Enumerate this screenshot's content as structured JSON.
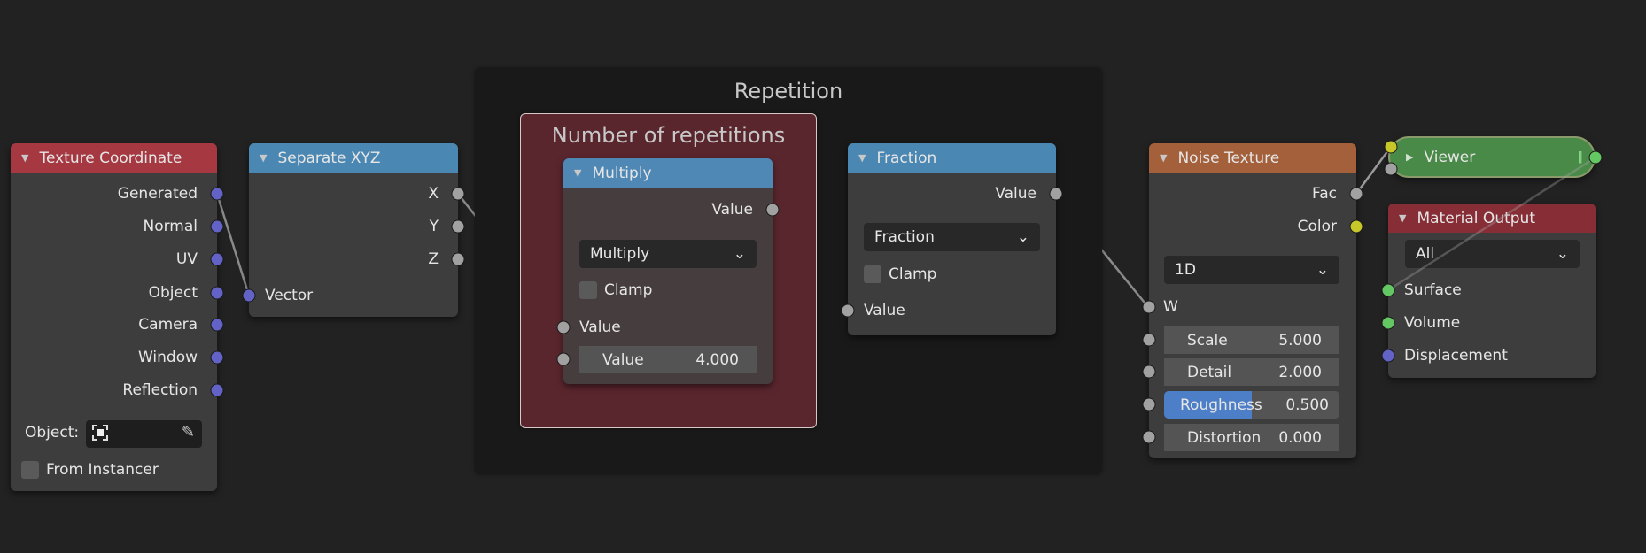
{
  "colors": {
    "background": "#222222",
    "frame": "#191919",
    "frame_inner": "#5a262e",
    "header_input": "#a53841",
    "header_converter": "#4a88b3",
    "header_texture": "#a3603a",
    "header_output": "#862d35",
    "viewer": "#4a8a48",
    "socket_vector": "#6363c7",
    "socket_float": "#a1a1a1",
    "socket_color": "#c7c729",
    "socket_shader": "#63c763",
    "slider_fill": "#4d7fc8"
  },
  "frames": {
    "outer": "Repetition",
    "inner": "Number of repetitions"
  },
  "texture_coordinate": {
    "title": "Texture Coordinate",
    "outputs": [
      "Generated",
      "Normal",
      "UV",
      "Object",
      "Camera",
      "Window",
      "Reflection"
    ],
    "object_label": "Object:",
    "object_icon": "object-icon",
    "eyedropper_icon": "eyedropper-icon",
    "from_instancer": "From Instancer",
    "from_instancer_checked": false
  },
  "separate_xyz": {
    "title": "Separate XYZ",
    "outputs": [
      "X",
      "Y",
      "Z"
    ],
    "input": "Vector"
  },
  "multiply": {
    "title": "Multiply",
    "output": "Value",
    "operation": "Multiply",
    "clamp": "Clamp",
    "clamp_checked": false,
    "input1": "Value",
    "input2_label": "Value",
    "input2_value": "4.000"
  },
  "fraction": {
    "title": "Fraction",
    "output": "Value",
    "operation": "Fraction",
    "clamp": "Clamp",
    "clamp_checked": false,
    "input": "Value"
  },
  "noise_texture": {
    "title": "Noise Texture",
    "outputs": [
      "Fac",
      "Color"
    ],
    "dimensions": "1D",
    "input_w": "W",
    "fields": [
      {
        "label": "Scale",
        "value": "5.000"
      },
      {
        "label": "Detail",
        "value": "2.000"
      },
      {
        "label": "Roughness",
        "value": "0.500",
        "fill": 0.5
      },
      {
        "label": "Distortion",
        "value": "0.000"
      }
    ]
  },
  "viewer": {
    "title": "Viewer"
  },
  "material_output": {
    "title": "Material Output",
    "target": "All",
    "inputs": [
      "Surface",
      "Volume",
      "Displacement"
    ]
  }
}
